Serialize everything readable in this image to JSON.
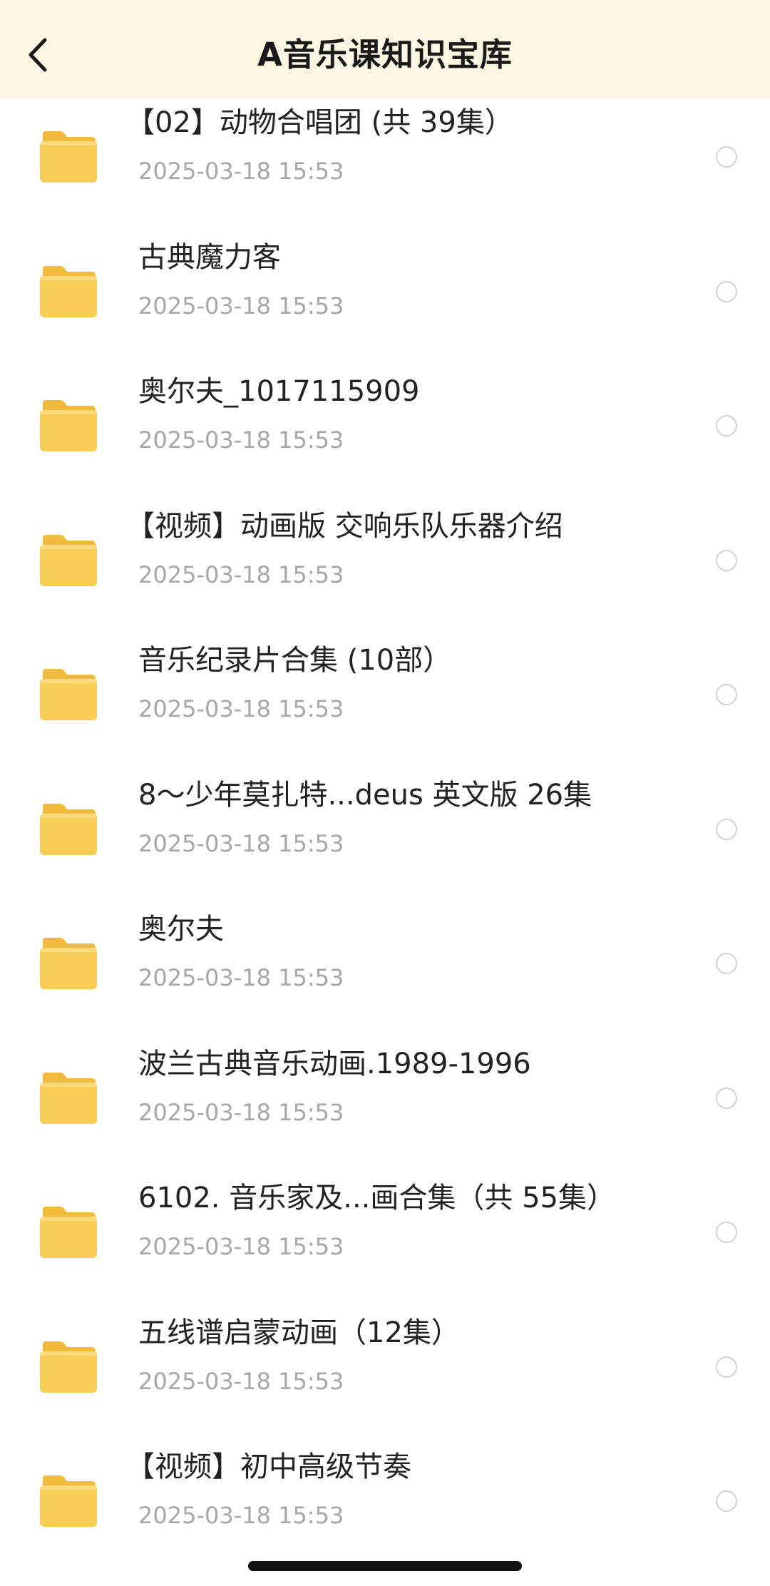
{
  "header": {
    "title": "A音乐课知识宝库",
    "back_icon": "chevron-left-icon"
  },
  "colors": {
    "header_bg": "#fdf6e3",
    "folder": "#f7cd55",
    "date_text": "#a6a6ab"
  },
  "items": [
    {
      "name": "【02】动物合唱团 (共 39集）",
      "date": "2025-03-18 15:53",
      "icon": "folder-icon"
    },
    {
      "name": "古典魔力客",
      "date": "2025-03-18 15:53",
      "icon": "folder-icon"
    },
    {
      "name": "奥尔夫_1017115909",
      "date": "2025-03-18 15:53",
      "icon": "folder-icon"
    },
    {
      "name": "【视频】动画版 交响乐队乐器介绍",
      "date": "2025-03-18 15:53",
      "icon": "folder-icon"
    },
    {
      "name": "音乐纪录片合集 (10部）",
      "date": "2025-03-18 15:53",
      "icon": "folder-icon"
    },
    {
      "name": "8～少年莫扎特...deus 英文版 26集",
      "date": "2025-03-18 15:53",
      "icon": "folder-icon"
    },
    {
      "name": "奥尔夫",
      "date": "2025-03-18 15:53",
      "icon": "folder-icon"
    },
    {
      "name": "波兰古典音乐动画.1989-1996",
      "date": "2025-03-18 15:53",
      "icon": "folder-icon"
    },
    {
      "name": "6102. 音乐家及...画合集（共 55集）",
      "date": "2025-03-18 15:53",
      "icon": "folder-icon"
    },
    {
      "name": "五线谱启蒙动画（12集）",
      "date": "2025-03-18 15:53",
      "icon": "folder-icon"
    },
    {
      "name": "【视频】初中高级节奏",
      "date": "2025-03-18 15:53",
      "icon": "folder-icon"
    }
  ]
}
